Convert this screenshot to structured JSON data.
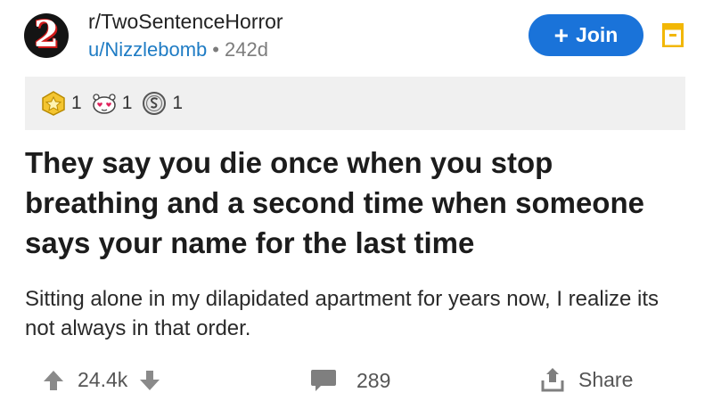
{
  "header": {
    "subreddit_badge": "2",
    "subreddit": "r/TwoSentenceHorror",
    "username": "u/Nizzlebomb",
    "separator": "•",
    "age": "242d",
    "join_label": "Join",
    "join_plus": "+"
  },
  "awards": [
    {
      "icon": "silver-award-icon",
      "count": "1"
    },
    {
      "icon": "wholesome-award-icon",
      "count": "1"
    },
    {
      "icon": "coin-award-icon",
      "count": "1"
    }
  ],
  "post": {
    "title": "They say you die once when you stop breathing and a second time when someone says your name for the last time",
    "body": "Sitting alone in my dilapidated apartment for years now, I realize its not always in that order."
  },
  "actions": {
    "score": "24.4k",
    "comments": "289",
    "share_label": "Share"
  },
  "colors": {
    "join_bg": "#1a73d9",
    "username": "#1f7cc4",
    "save_icon": "#f2b705",
    "awards_bg": "#f0f0f0",
    "action_icon": "#7f7f7f"
  }
}
